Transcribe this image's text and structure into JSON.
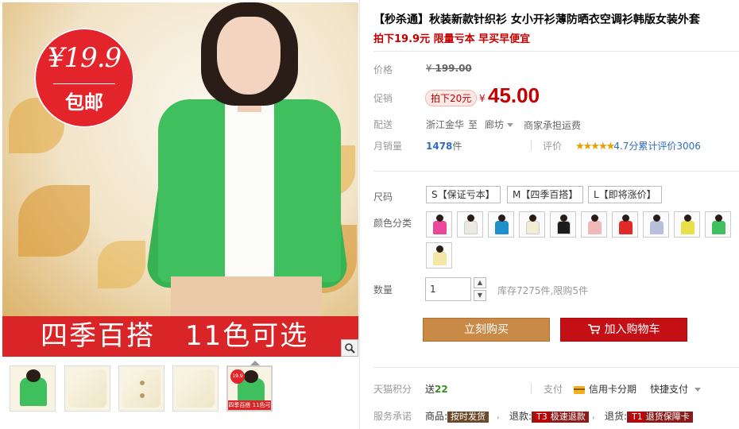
{
  "gallery": {
    "badge_price": "¥19.9",
    "badge_text": "包邮",
    "banner_left": "四季百搭",
    "banner_right": "11色可选",
    "zoom_icon": "magnifier-icon",
    "thumbnails": [
      {
        "kind": "model-green"
      },
      {
        "kind": "fabric-cream"
      },
      {
        "kind": "fabric-buttons"
      },
      {
        "kind": "fabric-sleeve"
      },
      {
        "kind": "promo",
        "price": "19.9",
        "caption": "四季百搭 11色可选"
      }
    ]
  },
  "product": {
    "title": "【秒杀通】秋装新款针织衫 女小开衫薄防晒衣空调衫韩版女装外套",
    "subtitle": "拍下19.9元 限量亏本 早买早便宜"
  },
  "price": {
    "label": "价格",
    "currency": "¥",
    "original": "199.00",
    "promo_label": "促销",
    "promo_tag": "拍下20元",
    "promo_currency": "¥",
    "promo_price": "45.00"
  },
  "shipping": {
    "label": "配送",
    "from": "浙江金华",
    "to_word": "至",
    "to": "廊坊",
    "note": "商家承担运费"
  },
  "sales": {
    "label": "月销量",
    "count": "1478",
    "unit": "件",
    "rating_label": "评价",
    "stars": "★★★★★",
    "rating_text": "4.7分累计评价3006"
  },
  "sizes": {
    "label": "尺码",
    "options": [
      "S【保证亏本】",
      "M【四季百搭】",
      "L【即将涨价】"
    ]
  },
  "colors": {
    "label": "颜色分类",
    "swatches": [
      "#e9489a",
      "#eceae0",
      "#1f8fc9",
      "#f5ecd6",
      "#1c1c1c",
      "#f1b8b8",
      "#e02a2a",
      "#b7bfdc",
      "#e9e04a",
      "#3fbf5d",
      "#f3e7a6"
    ]
  },
  "quantity": {
    "label": "数量",
    "value": "1",
    "stock": "库存7275件,限购5件"
  },
  "actions": {
    "buy_now": "立刻购买",
    "add_to_cart": "加入购物车",
    "cart_icon": "cart-icon"
  },
  "tmall": {
    "points_label": "天猫积分",
    "points_prefix": "送",
    "points_value": "22",
    "pay_label": "支付",
    "credit_card": "信用卡分期",
    "quick_pay": "快捷支付"
  },
  "service": {
    "label": "服务承诺",
    "goods_label": "商品:",
    "goods_tag": "按时发货",
    "refund_label": "退款:",
    "refund_code": "T3",
    "refund_tag": "极速退款",
    "return_label": "退货:",
    "return_code": "T1",
    "return_tag": "退货保障卡"
  },
  "colors_theme": {
    "accent_red": "#c40000",
    "buy_brown": "#c98a48",
    "cart_red": "#c40f14",
    "link_blue": "#2e6cbf"
  }
}
